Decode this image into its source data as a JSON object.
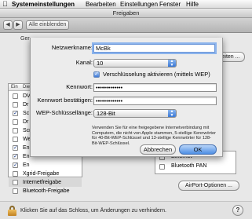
{
  "menubar": {
    "items": [
      "Systemeinstellungen",
      "Bearbeiten",
      "Einstellungen",
      "Fenster",
      "Hilfe"
    ]
  },
  "window": {
    "title": "Freigaben",
    "toolbar": {
      "show_all_label": "Alle einblenden"
    }
  },
  "background": {
    "computer_name_label_partial": "Ger",
    "edit_button_partial": "eiten ...",
    "list_header": {
      "on": "Ein",
      "service": "Dienst"
    },
    "services": [
      {
        "label": "DV",
        "checked": false
      },
      {
        "label": "Dr",
        "checked": false
      },
      {
        "label": "Sc",
        "checked": true
      },
      {
        "label": "Dr",
        "checked": false
      },
      {
        "label": "Scr",
        "checked": false
      },
      {
        "label": "We",
        "checked": false
      },
      {
        "label": "En",
        "checked": true
      },
      {
        "label": "En",
        "checked": true
      },
      {
        "label": "En",
        "checked": true
      },
      {
        "label": "Xgrid-Freigabe",
        "checked": false
      },
      {
        "label": "Internetfreigabe",
        "checked": false,
        "selected": true
      },
      {
        "label": "Bluetooth-Freigabe",
        "checked": false
      }
    ],
    "interfaces": [
      "Ethernet",
      "Bluetooth PAN"
    ],
    "airport_options_label": "AirPort-Optionen ..."
  },
  "status_bar": {
    "lock_text": "Klicken Sie auf das Schloss, um Änderungen zu verhindern.",
    "help_label": "?"
  },
  "sheet": {
    "network_name_label": "Netzwerkname:",
    "network_name_value": "McBk",
    "channel_label": "Kanal:",
    "channel_value": "10",
    "encryption_label": "Verschlüsselung aktivieren (mittels WEP)",
    "encryption_checked": true,
    "password_label": "Kennwort:",
    "password_value": "•••••••••••••",
    "confirm_label": "Kennwort bestätigen:",
    "confirm_value": "•••••••••••••",
    "wep_length_label": "WEP-Schlüssellänge:",
    "wep_length_value": "128-Bit",
    "help_text": "Verwenden Sie für eine freigegebene Internetverbindung mit Computern, die nicht von Apple stammen, 5-stellige Kennwörter für 40-Bit-WEP-Schlüssel und 13-stellige Kennwörter für 128-Bit-WEP-Schlüssel.",
    "cancel_label": "Abbrechen",
    "ok_label": "OK"
  },
  "colors": {
    "accent_blue": "#3d7ad8",
    "default_button": "#4d8ee4",
    "focus_ring": "#8cb4ec"
  }
}
